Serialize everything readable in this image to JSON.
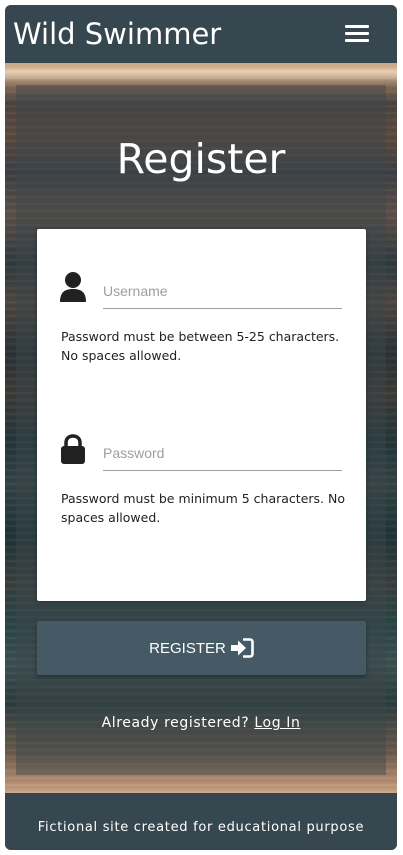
{
  "navbar": {
    "brand": "Wild Swimmer",
    "menu_icon": "hamburger-menu-icon"
  },
  "main": {
    "title": "Register",
    "username": {
      "icon": "user-icon",
      "placeholder": "Username",
      "value": "",
      "helper": "Password must be between 5-25 characters. No spaces allowed."
    },
    "password": {
      "icon": "lock-icon",
      "placeholder": "Password",
      "value": "",
      "helper": "Password must be minimum 5 characters. No spaces allowed."
    },
    "register_button": {
      "label": "REGISTER",
      "icon": "sign-in-icon"
    },
    "login_prompt": "Already registered?",
    "login_link": "Log In"
  },
  "footer": {
    "text": "Fictional site created for educational purpose"
  },
  "colors": {
    "navbar_bg": "#37474f",
    "button_bg": "#455a64",
    "card_bg": "#ffffff"
  }
}
